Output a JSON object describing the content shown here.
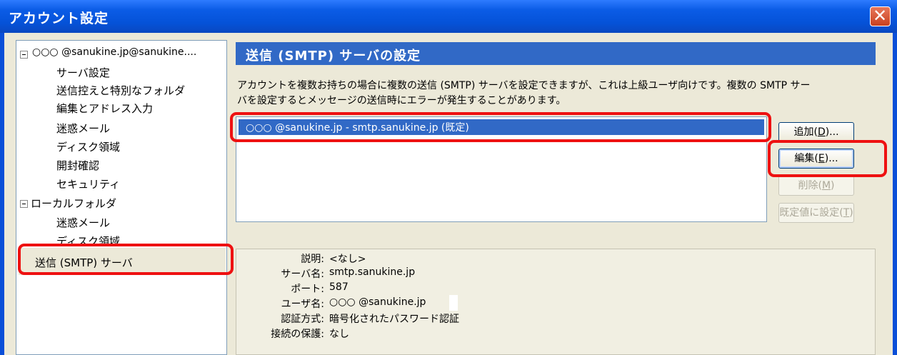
{
  "window": {
    "title": "アカウント設定",
    "close_glyph": "✕"
  },
  "tree": {
    "account_label": "○○○ @sanukine.jp@sanukine....",
    "account_children": [
      "サーバ設定",
      "送信控えと特別なフォルダ",
      "編集とアドレス入力",
      "迷惑メール",
      "ディスク領域",
      "開封確認",
      "セキュリティ"
    ],
    "local_label": "ローカルフォルダ",
    "local_children": [
      "迷惑メール",
      "ディスク領域"
    ],
    "smtp_label": "送信 (SMTP) サーバ"
  },
  "panel": {
    "heading": "送信 (SMTP) サーバの設定",
    "description_line1": "アカウントを複数お持ちの場合に複数の送信 (SMTP) サーバを設定できますが、これは上級ユーザ向けです。複数の SMTP サー",
    "description_line2": "バを設定するとメッセージの送信時にエラーが発生することがあります。",
    "server_list": [
      "○○○ @sanukine.jp - smtp.sanukine.jp (既定)"
    ],
    "buttons": {
      "add": "追加(D)...",
      "edit": "編集(E)...",
      "delete": "削除(M)",
      "set_default": "既定値に設定(T)"
    },
    "details": {
      "description_label": "説明:",
      "description_value": "<なし>",
      "server_label": "サーバ名:",
      "server_value": "smtp.sanukine.jp",
      "port_label": "ポート:",
      "port_value": "587",
      "user_label": "ユーザ名:",
      "user_value": "○○○ @sanukine.jp",
      "auth_label": "認証方式:",
      "auth_value": "暗号化されたパスワード認証",
      "security_label": "接続の保護:",
      "security_value": "なし"
    }
  }
}
